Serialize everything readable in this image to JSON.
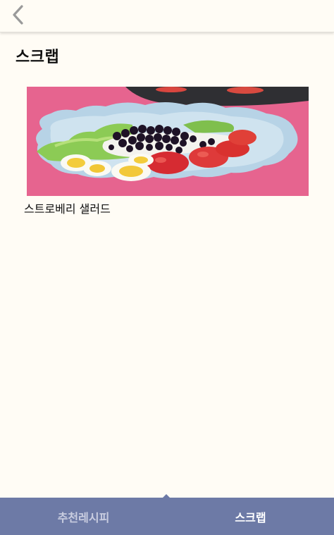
{
  "header": {
    "back_icon": "chevron-left-icon"
  },
  "page": {
    "title": "스크랩"
  },
  "scraps": [
    {
      "title": "스트로베리 샐러드",
      "image": "strawberry-salad-photo"
    }
  ],
  "tabs": [
    {
      "label": "추천레시피",
      "active": false
    },
    {
      "label": "스크랩",
      "active": true
    }
  ],
  "colors": {
    "background": "#fffcf5",
    "tabbar": "#6d7aa6",
    "tab_active_text": "#ffffff",
    "tab_inactive_text": "#c9cde0"
  }
}
